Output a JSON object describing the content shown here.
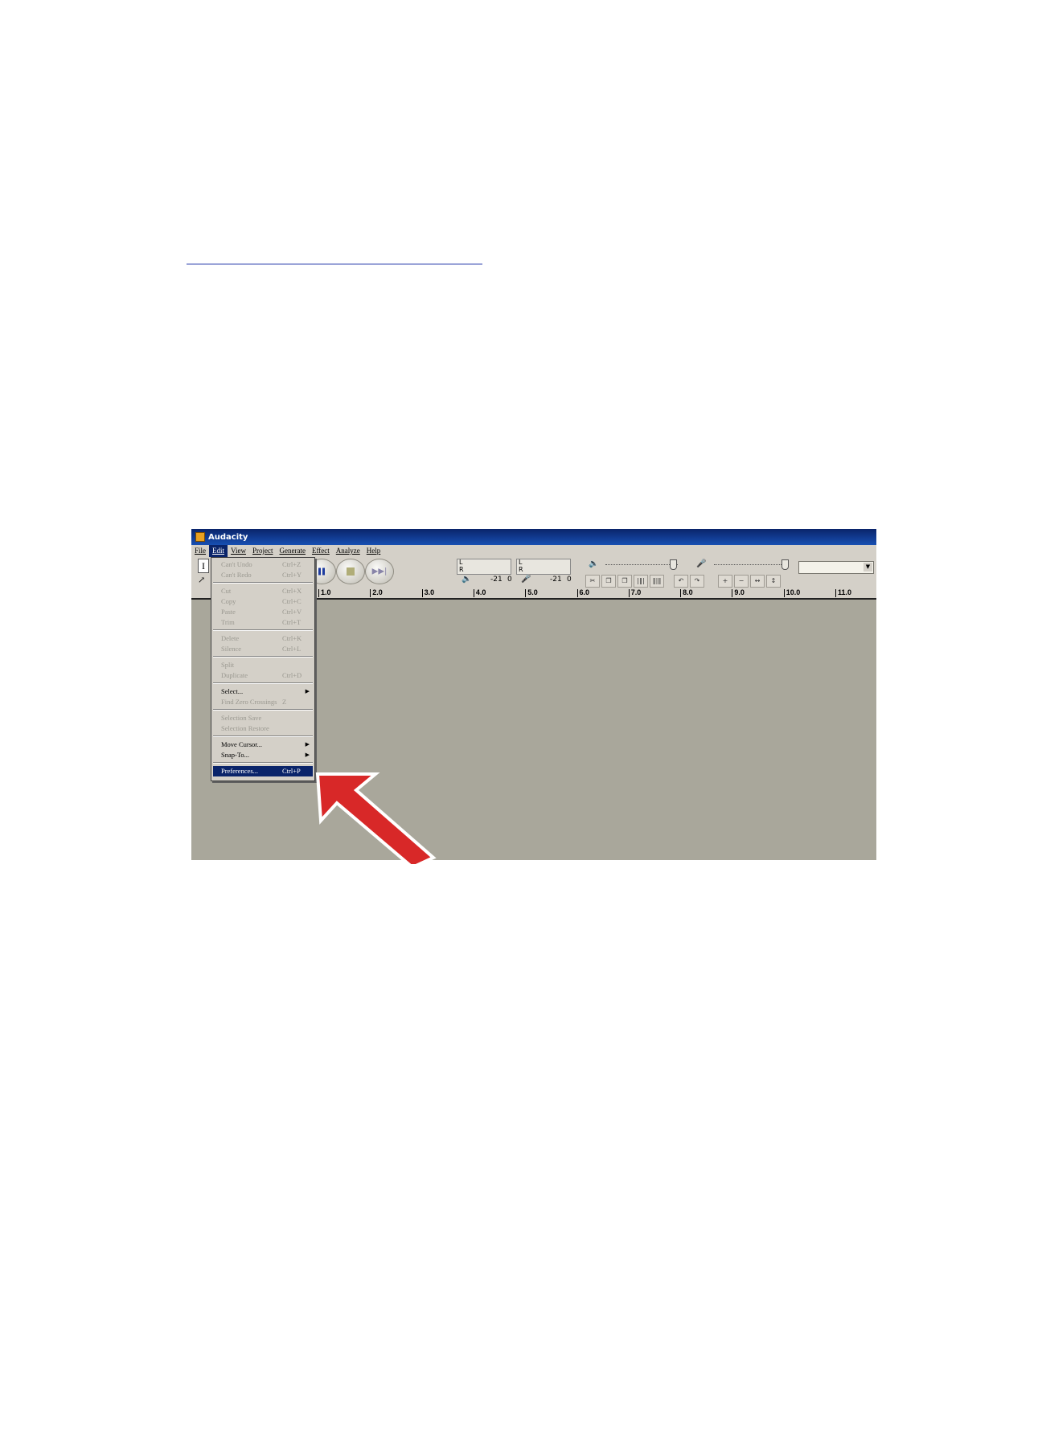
{
  "window": {
    "title": "Audacity"
  },
  "menubar": [
    "File",
    "Edit",
    "View",
    "Project",
    "Generate",
    "Effect",
    "Analyze",
    "Help"
  ],
  "meters": {
    "left": "L",
    "right": "R",
    "play_scale": [
      "-21",
      "0"
    ],
    "rec_scale": [
      "-21",
      "0"
    ]
  },
  "edit_menu": {
    "groups": [
      [
        {
          "label": "Can't Undo",
          "shortcut": "Ctrl+Z"
        },
        {
          "label": "Can't Redo",
          "shortcut": "Ctrl+Y"
        }
      ],
      [
        {
          "label": "Cut",
          "shortcut": "Ctrl+X"
        },
        {
          "label": "Copy",
          "shortcut": "Ctrl+C"
        },
        {
          "label": "Paste",
          "shortcut": "Ctrl+V"
        },
        {
          "label": "Trim",
          "shortcut": "Ctrl+T"
        }
      ],
      [
        {
          "label": "Delete",
          "shortcut": "Ctrl+K"
        },
        {
          "label": "Silence",
          "shortcut": "Ctrl+L"
        }
      ],
      [
        {
          "label": "Split",
          "shortcut": ""
        },
        {
          "label": "Duplicate",
          "shortcut": "Ctrl+D"
        }
      ],
      [
        {
          "label": "Select...",
          "shortcut": "",
          "submenu": true,
          "enabled": true
        },
        {
          "label": "Find Zero Crossings",
          "shortcut": "Z"
        }
      ],
      [
        {
          "label": "Selection Save",
          "shortcut": ""
        },
        {
          "label": "Selection Restore",
          "shortcut": ""
        }
      ],
      [
        {
          "label": "Move Cursor...",
          "shortcut": "",
          "submenu": true,
          "enabled": true
        },
        {
          "label": "Snap-To...",
          "shortcut": "",
          "submenu": true,
          "enabled": true
        }
      ],
      [
        {
          "label": "Preferences...",
          "shortcut": "Ctrl+P",
          "enabled": true,
          "highlighted": true
        }
      ]
    ]
  },
  "ruler": [
    "1.0",
    "2.0",
    "3.0",
    "4.0",
    "5.0",
    "6.0",
    "7.0",
    "8.0",
    "9.0",
    "10.0",
    "11.0"
  ],
  "icons": {
    "app": "audacity-icon",
    "speaker": "speaker-icon",
    "mic": "microphone-icon",
    "record": "record-icon",
    "pause": "pause-icon",
    "stop": "stop-icon",
    "skip_end": "skip-end-icon",
    "callout": "red-arrow-icon"
  },
  "colors": {
    "menu_highlight": "#0a246a",
    "record": "#c83232",
    "pause": "#1e3ca0",
    "track_area": "#a9a79b",
    "callout_arrow": "#d82828"
  }
}
